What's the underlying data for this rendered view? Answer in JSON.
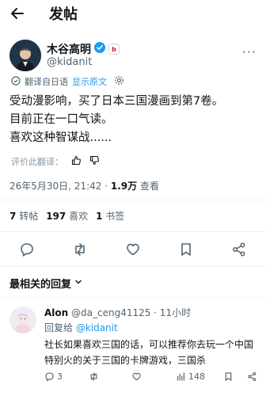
{
  "header": {
    "title": "发帖"
  },
  "author": {
    "name": "木谷高明",
    "org_badge": "b",
    "handle": "@kidanit"
  },
  "translation": {
    "label": "翻译自日语",
    "show_original": "显示原文"
  },
  "post": {
    "lines": [
      "受动漫影响，买了日本三国漫画到第7卷。",
      "目前正在一口气读。",
      "喜欢这种智谋战......"
    ]
  },
  "rate": {
    "label": "评价此翻译："
  },
  "meta": {
    "timestamp": "26年5月30日, 21:42 · ",
    "views_count": "1.9万",
    "views_label": "查看"
  },
  "stats": {
    "reposts_count": "7",
    "reposts_label": "转帖",
    "likes_count": "197",
    "likes_label": "喜欢",
    "bookmarks_count": "1",
    "bookmarks_label": "书签"
  },
  "replies_section": {
    "title": "最相关的回复"
  },
  "reply": {
    "name": "Alon",
    "handle_time": "@da_ceng41125 · 11小时",
    "replying_to_label": "回复给",
    "replying_to_handle": "@kidanit",
    "text": "社长如果喜欢三国的话，可以推荐你去玩一个中国特别火的关于三国的卡牌游戏，三国杀",
    "replies_count": "3",
    "views_count": "148"
  },
  "colors": {
    "accent": "#1d9bf0",
    "secondary_text": "#536471",
    "divider": "#eff3f4"
  }
}
